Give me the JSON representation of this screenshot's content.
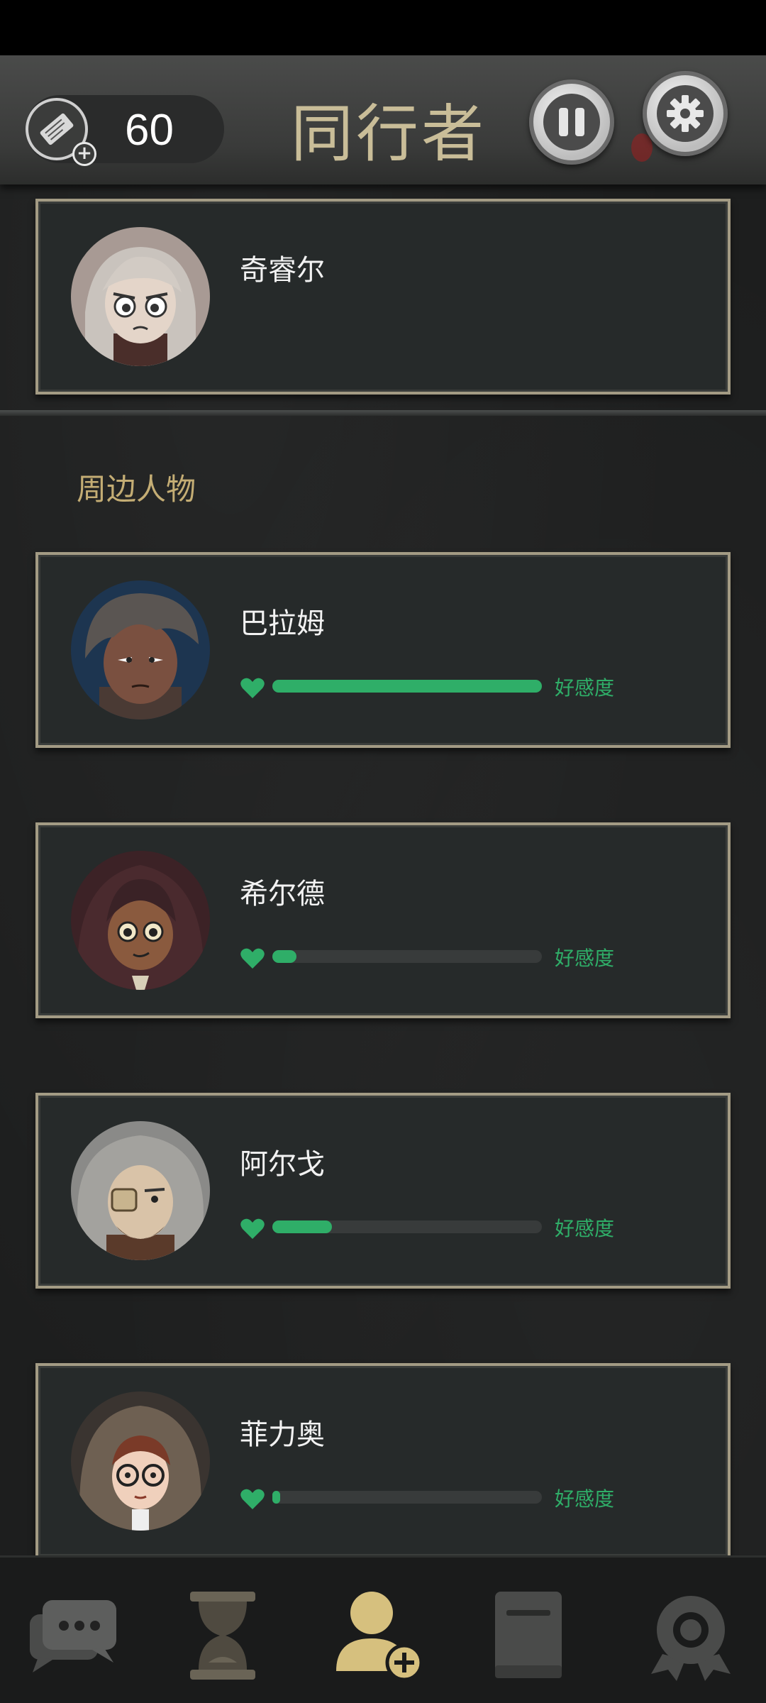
{
  "header": {
    "tickets": "60",
    "title": "同行者"
  },
  "companion": {
    "name": "奇睿尔"
  },
  "section": {
    "title": "周边人物"
  },
  "characters": [
    {
      "name": "巴拉姆",
      "affinity": 1.0,
      "affinity_label": "好感度"
    },
    {
      "name": "希尔德",
      "affinity": 0.09,
      "affinity_label": "好感度"
    },
    {
      "name": "阿尔戈",
      "affinity": 0.22,
      "affinity_label": "好感度"
    },
    {
      "name": "菲力奥",
      "affinity": 0.03,
      "affinity_label": "好感度"
    }
  ],
  "nav": {
    "items": [
      "chat-icon",
      "hourglass-icon",
      "companions-icon",
      "journal-icon",
      "achievements-icon"
    ],
    "active": "companions-icon"
  },
  "colors": {
    "accent_gold": "#c9bd98",
    "affinity_green": "#2fae68",
    "card_border": "#a39b84"
  }
}
